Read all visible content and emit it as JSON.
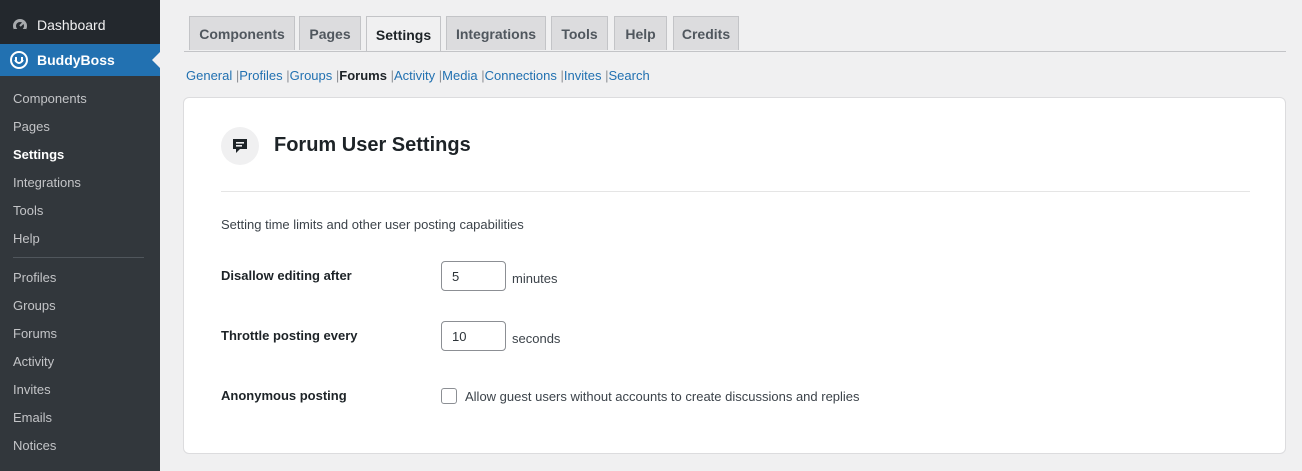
{
  "sidebar": {
    "dashboard_label": "Dashboard",
    "dashboard_icon": "dashboard-icon",
    "plugin_label": "BuddyBoss",
    "plugin_icon": "buddyboss-icon",
    "accent_color": "#2271b1",
    "items": [
      {
        "label": "Components"
      },
      {
        "label": "Pages"
      },
      {
        "label": "Settings",
        "current": true
      },
      {
        "label": "Integrations"
      },
      {
        "label": "Tools"
      },
      {
        "label": "Help"
      },
      {
        "label": "Profiles"
      },
      {
        "label": "Groups"
      },
      {
        "label": "Forums"
      },
      {
        "label": "Activity"
      },
      {
        "label": "Invites"
      },
      {
        "label": "Emails"
      },
      {
        "label": "Notices"
      }
    ]
  },
  "tabs": [
    {
      "label": "Components"
    },
    {
      "label": "Pages"
    },
    {
      "label": "Settings",
      "active": true
    },
    {
      "label": "Integrations"
    },
    {
      "label": "Tools"
    },
    {
      "label": "Help"
    },
    {
      "label": "Credits"
    }
  ],
  "subnav": {
    "separator": "|",
    "items": [
      {
        "label": "General"
      },
      {
        "label": "Profiles"
      },
      {
        "label": "Groups"
      },
      {
        "label": "Forums",
        "current": true
      },
      {
        "label": "Activity"
      },
      {
        "label": "Media"
      },
      {
        "label": "Connections"
      },
      {
        "label": "Invites"
      },
      {
        "label": "Search"
      }
    ]
  },
  "card": {
    "icon": "forum-chat-icon",
    "title": "Forum User Settings",
    "description": "Setting time limits and other user posting capabilities",
    "edit_label": "Disallow editing after",
    "edit_value": "5",
    "edit_unit": "minutes",
    "throttle_label": "Throttle posting every",
    "throttle_value": "10",
    "throttle_unit": "seconds",
    "anon_label": "Anonymous posting",
    "anon_checkbox_label": "Allow guest users without accounts to create discussions and replies",
    "anon_checked": false
  }
}
